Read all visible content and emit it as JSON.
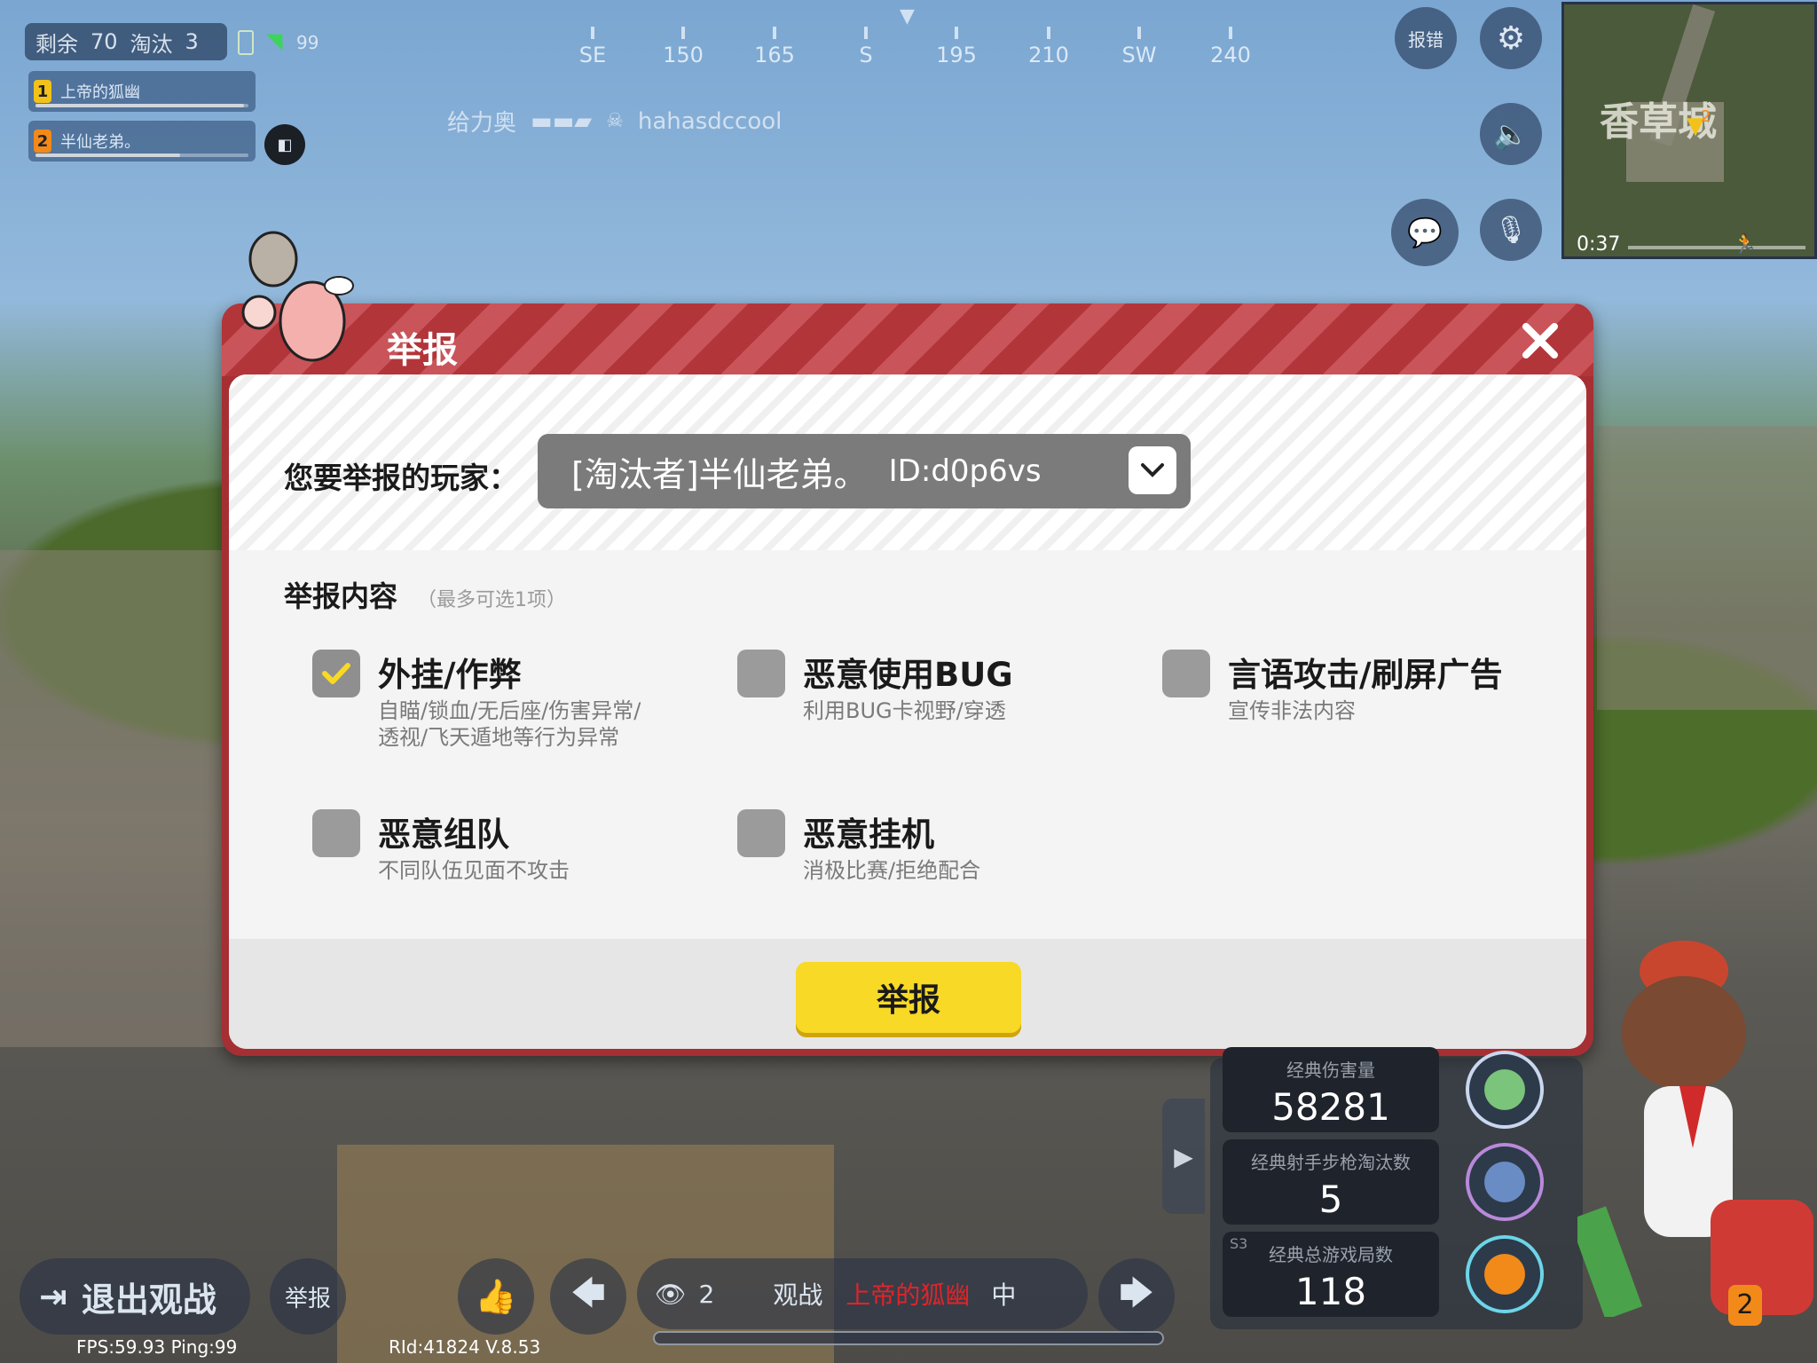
{
  "hud": {
    "remaining_label": "剩余",
    "remaining_value": "70",
    "eliminated_label": "淘汰",
    "eliminated_value": "3",
    "signal_value": "99",
    "team": [
      {
        "num": "1",
        "name": "上帝的狐幽",
        "health": 0.98
      },
      {
        "num": "2",
        "name": "半仙老弟。",
        "health": 0.68
      }
    ],
    "compass": [
      "SE",
      "150",
      "165",
      "S",
      "195",
      "210",
      "SW",
      "240"
    ],
    "killfeed": {
      "killer": "给力奥",
      "victim": "hahasdccool"
    },
    "report_bug_label": "报错",
    "minimap": {
      "location": "香草城",
      "timer": "0:37",
      "marker_num": "2"
    }
  },
  "dialog": {
    "title": "举报",
    "player_label": "您要举报的玩家：",
    "player_selected": "[淘汰者]半仙老弟。",
    "player_id": "ID:d0p6vs",
    "content_title": "举报内容",
    "content_hint": "（最多可选1项）",
    "options": [
      {
        "title": "外挂/作弊",
        "desc1": "自瞄/锁血/无后座/伤害异常/",
        "desc2": "透视/飞天遁地等行为异常",
        "checked": true
      },
      {
        "title": "恶意使用BUG",
        "desc1": "利用BUG卡视野/穿透",
        "desc2": "",
        "checked": false
      },
      {
        "title": "言语攻击/刷屏广告",
        "desc1": "宣传非法内容",
        "desc2": "",
        "checked": false
      },
      {
        "title": "恶意组队",
        "desc1": "不同队伍见面不攻击",
        "desc2": "",
        "checked": false
      },
      {
        "title": "恶意挂机",
        "desc1": "消极比赛/拒绝配合",
        "desc2": "",
        "checked": false
      }
    ],
    "submit_label": "举报"
  },
  "stats": [
    {
      "label": "经典伤害量",
      "value": "58281"
    },
    {
      "label": "经典射手步枪淘汰数",
      "value": "5"
    },
    {
      "label": "经典总游戏局数",
      "value": "118",
      "season": "S3"
    }
  ],
  "bottom": {
    "exit_label": "退出观战",
    "report_label": "举报",
    "viewers": "2",
    "spectate_label": "观战",
    "spectate_target": "上帝的狐幽",
    "spectate_suffix": "中",
    "fps": "FPS:59.93 Ping:99",
    "version": "RId:41824 V.8.53",
    "character_badge": "2"
  },
  "colors": {
    "accent_yellow": "#f7d926",
    "dialog_red": "#a62f34",
    "target_red": "#e0242a"
  }
}
